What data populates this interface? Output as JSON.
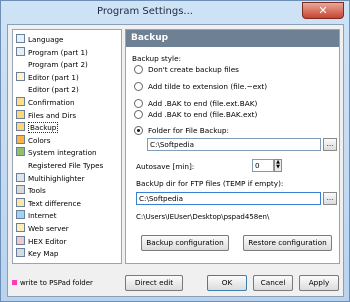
{
  "window": {
    "title": "Program Settings..."
  },
  "tree": {
    "items": [
      {
        "label": "Language",
        "icon": "language-icon",
        "selected": false
      },
      {
        "label": "Program  (part 1)",
        "icon": "program-icon",
        "selected": false
      },
      {
        "label": "Program  (part 2)",
        "icon": "",
        "selected": false
      },
      {
        "label": "Editor  (part 1)",
        "icon": "editor-icon",
        "selected": false
      },
      {
        "label": "Editor  (part 2)",
        "icon": "",
        "selected": false
      },
      {
        "label": "Confirmation",
        "icon": "confirmation-icon",
        "selected": false
      },
      {
        "label": "Files and Dirs",
        "icon": "folder-icon",
        "selected": false
      },
      {
        "label": "Backup",
        "icon": "backup-icon",
        "selected": true
      },
      {
        "label": "Colors",
        "icon": "colors-icon",
        "selected": false
      },
      {
        "label": "System integration",
        "icon": "windows-icon",
        "selected": false
      },
      {
        "label": "Registered File Types",
        "icon": "",
        "selected": false
      },
      {
        "label": "Multihighlighter",
        "icon": "highlighter-icon",
        "selected": false
      },
      {
        "label": "Tools",
        "icon": "tools-icon",
        "selected": false
      },
      {
        "label": "Text difference",
        "icon": "diff-icon",
        "selected": false
      },
      {
        "label": "Internet",
        "icon": "globe-icon",
        "selected": false
      },
      {
        "label": "Web server",
        "icon": "web-server-icon",
        "selected": false
      },
      {
        "label": "HEX Editor",
        "icon": "hex-icon",
        "selected": false
      },
      {
        "label": "Key Map",
        "icon": "keyboard-icon",
        "selected": false
      }
    ]
  },
  "panel": {
    "header": "Backup",
    "backup_style_label": "Backup style:",
    "options": [
      {
        "label": "Don't create backup files",
        "checked": false
      },
      {
        "label": "Add tilde to extension (file.~ext)",
        "checked": false
      },
      {
        "label": "Add .BAK to end (file.ext.BAK)",
        "checked": false
      },
      {
        "label": "Add .BAK to end (file.BAK.ext)",
        "checked": false
      },
      {
        "label": "Folder for File Backup:",
        "checked": true
      }
    ],
    "folder_value": "C:\\Softpedia",
    "autosave_label": "Autosave [min]:",
    "autosave_value": "0",
    "ftp_label": "BackUp dir for FTP files (TEMP if empty):",
    "ftp_value": "C:\\Softpedia",
    "path_text": "C:\\Users\\IEUser\\Desktop\\pspad458en\\",
    "backup_config_label": "Backup configuration",
    "restore_config_label": "Restore configuration",
    "browse_label": "..."
  },
  "footer": {
    "note": "write to PSPad folder",
    "direct_edit": "Direct edit",
    "ok": "OK",
    "cancel": "Cancel",
    "apply": "Apply"
  },
  "colors": {
    "header_bg": "#6e8093",
    "accent": "#3c7fb1",
    "close": "#c7442f",
    "note_marker": "#ff3cb4"
  }
}
